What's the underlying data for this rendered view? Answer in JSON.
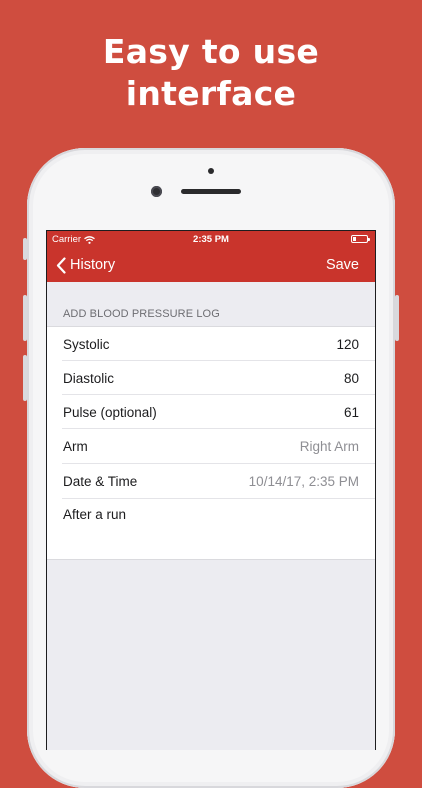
{
  "promo": {
    "line1": "Easy to use",
    "line2": "interface"
  },
  "status_bar": {
    "carrier": "Carrier",
    "time": "2:35 PM",
    "battery_level": 0.2
  },
  "nav": {
    "back_label": "History",
    "save_label": "Save"
  },
  "form": {
    "section_header": "ADD BLOOD PRESSURE LOG",
    "rows": [
      {
        "label": "Systolic",
        "value": "120"
      },
      {
        "label": "Diastolic",
        "value": "80"
      },
      {
        "label": "Pulse (optional)",
        "value": "61"
      },
      {
        "label": "Arm",
        "value": "Right Arm"
      },
      {
        "label": "Date & Time",
        "value": "10/14/17, 2:35 PM"
      }
    ],
    "notes": "After a run"
  },
  "colors": {
    "background": "#cf4d3f",
    "nav_bar": "#c9342c",
    "muted_text": "#8e8e93"
  }
}
